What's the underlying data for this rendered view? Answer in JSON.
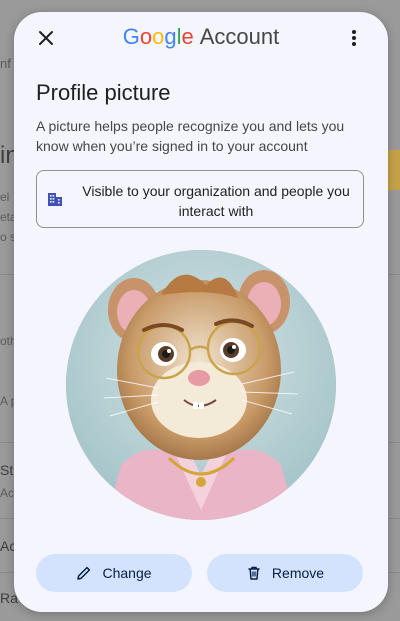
{
  "background": {
    "fragments": [
      "nf",
      "in",
      "el",
      "eta",
      "o s",
      "oth",
      "A p",
      "St",
      "Ac",
      "Ac",
      "Ra"
    ]
  },
  "header": {
    "brand": {
      "letters": [
        "G",
        "o",
        "o",
        "g",
        "l",
        "e"
      ],
      "suffix": "Account"
    },
    "close_icon": "close-icon",
    "more_icon": "more-vert-icon"
  },
  "dialog": {
    "title": "Profile picture",
    "description": "A picture helps people recognize you and lets you know when you’re signed in to your account",
    "visibility": {
      "icon": "domain-icon",
      "text": "Visible to your organization and people you interact with"
    },
    "avatar": {
      "image": "profile-photo-hamster-with-glasses"
    },
    "actions": {
      "change_label": "Change",
      "change_icon": "pencil-icon",
      "remove_label": "Remove",
      "remove_icon": "trash-icon"
    }
  },
  "colors": {
    "modal_bg": "#f5f6fd",
    "button_bg": "#d3e3fd",
    "button_text": "#041e49",
    "org_icon": "#3f51b5",
    "google_blue": "#4285f4",
    "google_red": "#ea4335",
    "google_yellow": "#fbbc05",
    "google_green": "#34a853"
  }
}
